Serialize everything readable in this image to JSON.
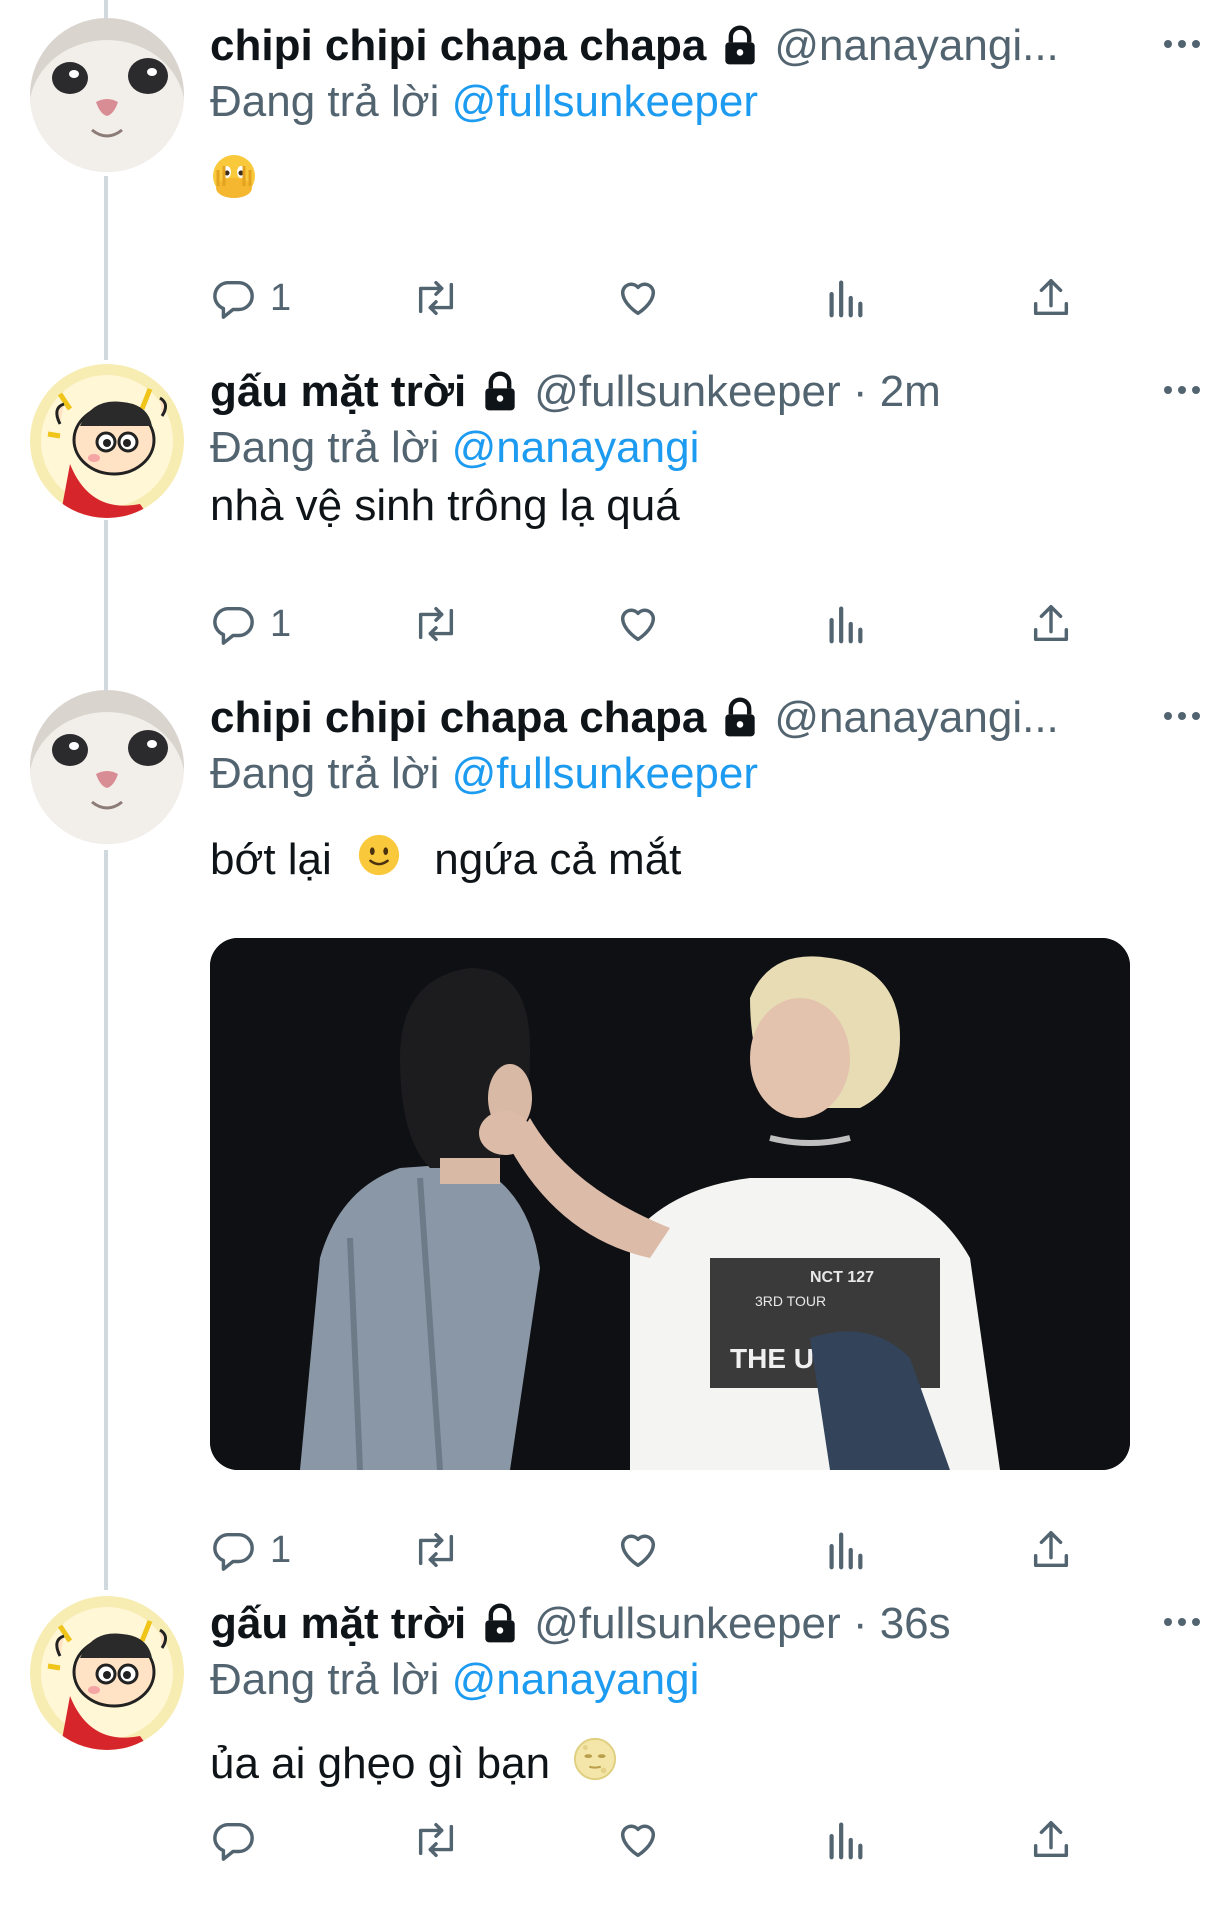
{
  "colors": {
    "primary_text": "#0f1419",
    "secondary_text": "#536471",
    "link": "#1d9bf0",
    "thread_line": "#cfd9de",
    "icon": "#536471"
  },
  "tweets": [
    {
      "display_name": "chipi chipi chapa chapa",
      "handle": "@nanayangi...",
      "time": "",
      "reply_prefix": "Đang trả lời",
      "reply_to": "@fullsunkeeper",
      "text": "",
      "emoji": "face-with-hand-over-mouth-peeking",
      "avatar": "white-cat-avatar",
      "actions": {
        "reply_count": "1",
        "retweet_count": "",
        "like_count": "",
        "views_count": ""
      }
    },
    {
      "display_name": "gấu mặt trời",
      "handle": "@fullsunkeeper · 2m",
      "time": "2m",
      "reply_prefix": "Đang trả lời",
      "reply_to": "@nanayangi",
      "text": "nhà vệ sinh trông lạ quá",
      "avatar": "cartoon-boy-avatar",
      "actions": {
        "reply_count": "1",
        "retweet_count": "",
        "like_count": "",
        "views_count": ""
      }
    },
    {
      "display_name": "chipi chipi chapa chapa",
      "handle": "@nanayangi...",
      "time": "",
      "reply_prefix": "Đang trả lời",
      "reply_to": "@fullsunkeeper",
      "text_before": "bớt lại",
      "text_after": "ngứa cả mắt",
      "emoji": "slightly-smiling-face",
      "avatar": "white-cat-avatar",
      "media": {
        "description_icon": "concert-photo",
        "shirt_text_1": "NCT 127",
        "shirt_text_2": "3RD TOUR",
        "shirt_text_3": "THE UNITY"
      },
      "actions": {
        "reply_count": "1",
        "retweet_count": "",
        "like_count": "",
        "views_count": ""
      }
    },
    {
      "display_name": "gấu mặt trời",
      "handle": "@fullsunkeeper · 36s",
      "time": "36s",
      "reply_prefix": "Đang trả lời",
      "reply_to": "@nanayangi",
      "text": "ủa ai ghẹo gì bạn",
      "emoji": "new-moon-face",
      "avatar": "cartoon-boy-avatar",
      "actions": {
        "reply_count": "",
        "retweet_count": "",
        "like_count": "",
        "views_count": ""
      }
    }
  ]
}
